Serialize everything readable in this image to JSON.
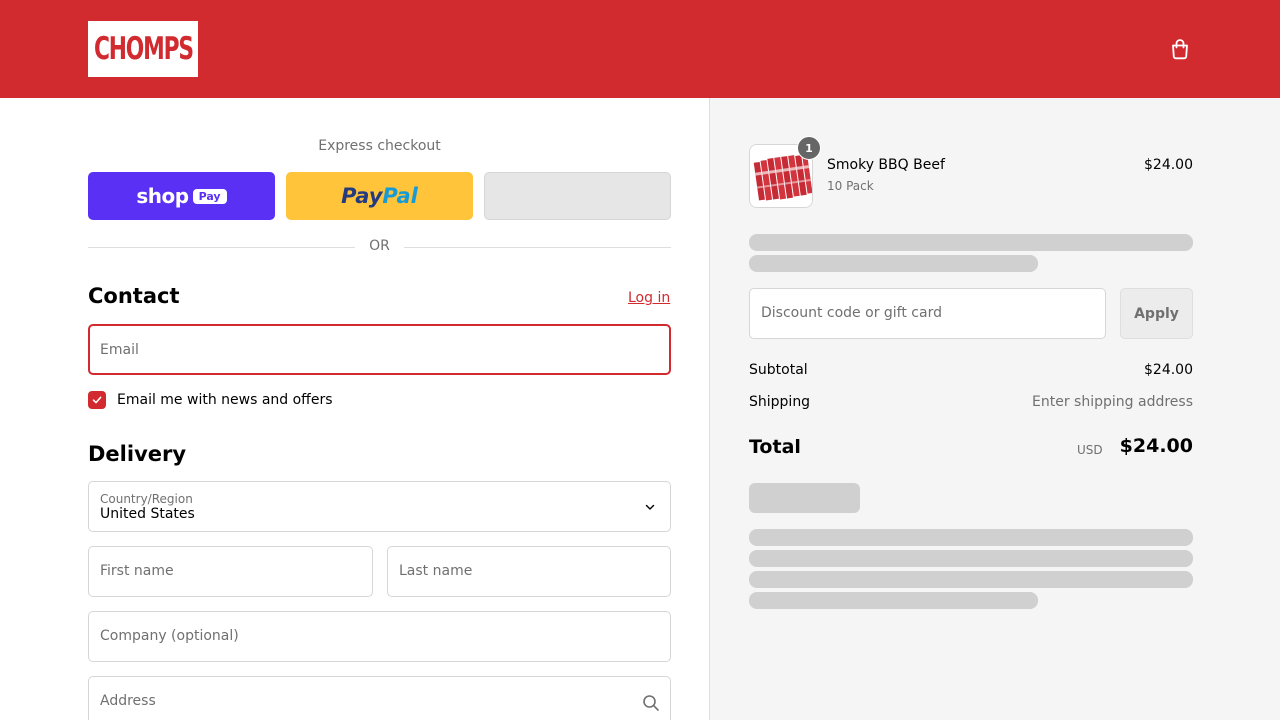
{
  "header": {
    "logo_text": "CHOMPS",
    "brand_color": "#d12a2f",
    "cart_icon": "shopping-bag-icon"
  },
  "express": {
    "title": "Express checkout",
    "shop_pay_word": "shop",
    "shop_pay_pill": "Pay",
    "paypal_part1": "Pay",
    "paypal_part2": "Pal",
    "or_label": "OR"
  },
  "contact": {
    "heading": "Contact",
    "login_link": "Log in",
    "email_placeholder": "Email",
    "newsletter_label": "Email me with news and offers",
    "newsletter_checked": true
  },
  "delivery": {
    "heading": "Delivery",
    "country_label": "Country/Region",
    "country_value": "United States",
    "first_name_placeholder": "First name",
    "last_name_placeholder": "Last name",
    "company_placeholder": "Company (optional)",
    "address_placeholder": "Address"
  },
  "summary": {
    "item": {
      "name": "Smoky BBQ Beef",
      "variant": "10 Pack",
      "price": "$24.00",
      "quantity": "1"
    },
    "discount_placeholder": "Discount code or gift card",
    "apply_label": "Apply",
    "subtotal_label": "Subtotal",
    "subtotal_value": "$24.00",
    "shipping_label": "Shipping",
    "shipping_value": "Enter shipping address",
    "total_label": "Total",
    "total_currency": "USD",
    "total_value": "$24.00"
  }
}
